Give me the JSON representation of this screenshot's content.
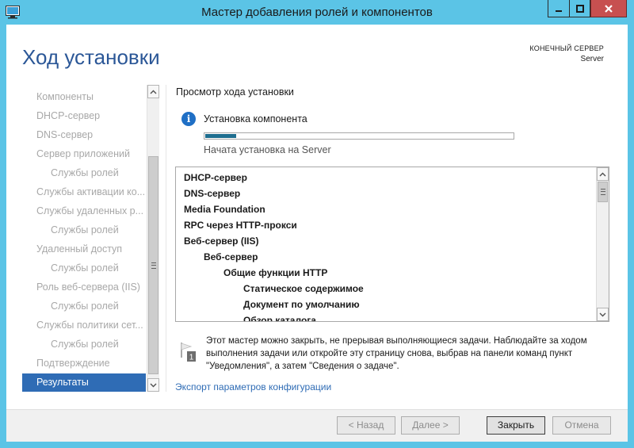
{
  "window": {
    "title": "Мастер добавления ролей и компонентов"
  },
  "header": {
    "page_title": "Ход установки",
    "destination_label": "КОНЕЧНЫЙ СЕРВЕР",
    "destination_server": "Server"
  },
  "nav": {
    "items": [
      {
        "label": "Компоненты"
      },
      {
        "label": "DHCP-сервер"
      },
      {
        "label": "DNS-сервер"
      },
      {
        "label": "Сервер приложений"
      },
      {
        "label": "Службы ролей"
      },
      {
        "label": "Службы активации ко..."
      },
      {
        "label": "Службы удаленных р..."
      },
      {
        "label": "Службы ролей"
      },
      {
        "label": "Удаленный доступ"
      },
      {
        "label": "Службы ролей"
      },
      {
        "label": "Роль веб-сервера (IIS)"
      },
      {
        "label": "Службы ролей"
      },
      {
        "label": "Службы политики сет..."
      },
      {
        "label": "Службы ролей"
      },
      {
        "label": "Подтверждение"
      },
      {
        "label": "Результаты"
      }
    ],
    "active_index": 15
  },
  "main": {
    "heading": "Просмотр хода установки",
    "status_label": "Установка компонента",
    "progress_fraction": 0.1,
    "progress_text": "Начата установка на Server",
    "features": [
      {
        "label": "DHCP-сервер",
        "level": 0
      },
      {
        "label": "DNS-сервер",
        "level": 0
      },
      {
        "label": "Media Foundation",
        "level": 0
      },
      {
        "label": "RPC через HTTP-прокси",
        "level": 0
      },
      {
        "label": "Веб-сервер (IIS)",
        "level": 0
      },
      {
        "label": "Веб-сервер",
        "level": 1
      },
      {
        "label": "Общие функции HTTP",
        "level": 2
      },
      {
        "label": "Статическое содержимое",
        "level": 3
      },
      {
        "label": "Документ по умолчанию",
        "level": 3
      },
      {
        "label": "Обзор каталога",
        "level": 3
      }
    ],
    "note_badge": "1",
    "note_text": "Этот мастер можно закрыть, не прерывая выполняющиеся задачи. Наблюдайте за ходом выполнения задачи или откройте эту страницу снова, выбрав на панели команд пункт \"Уведомления\", а затем \"Сведения о задаче\".",
    "export_link": "Экспорт параметров конфигурации"
  },
  "footer": {
    "back_label": "< Назад",
    "next_label": "Далее >",
    "close_label": "Закрыть",
    "cancel_label": "Отмена"
  },
  "colors": {
    "chrome": "#5bc4e6",
    "accent": "#2f6cb5",
    "title_blue": "#2b5797",
    "progress": "#1e6e8f"
  }
}
